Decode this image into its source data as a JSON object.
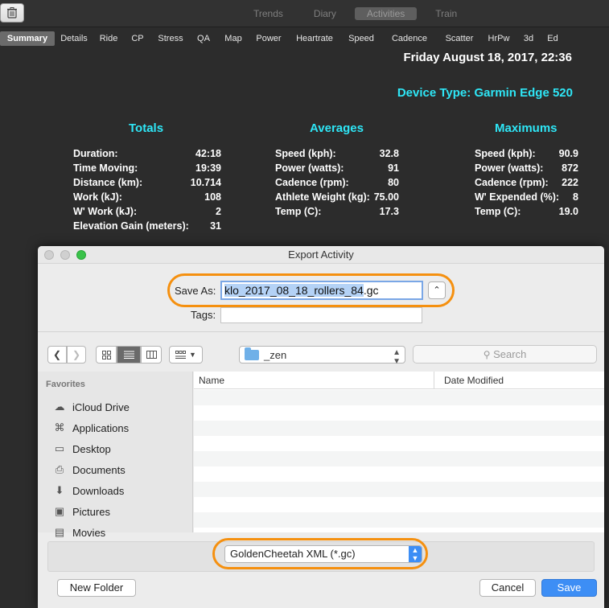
{
  "topbar": {
    "views": [
      "Trends",
      "Diary",
      "Activities",
      "Train"
    ],
    "active_view": 2
  },
  "tabs": {
    "items": [
      "Summary",
      "Details",
      "Ride",
      "CP",
      "Stress",
      "QA",
      "Map",
      "Power",
      "Heartrate",
      "Speed",
      "Cadence",
      "Scatter",
      "HrPw",
      "3d",
      "Ed"
    ],
    "active": 0
  },
  "summary": {
    "date": "Friday August 18, 2017, 22:36",
    "device": "Device Type: Garmin Edge 520",
    "totals": {
      "title": "Totals",
      "rows": [
        {
          "label": "Duration:",
          "value": "42:18"
        },
        {
          "label": "Time Moving:",
          "value": "19:39"
        },
        {
          "label": "Distance (km):",
          "value": "10.714"
        },
        {
          "label": "Work (kJ):",
          "value": "108"
        },
        {
          "label": "W' Work (kJ):",
          "value": "2"
        },
        {
          "label": "Elevation Gain (meters):",
          "value": "31"
        }
      ]
    },
    "averages": {
      "title": "Averages",
      "rows": [
        {
          "label": "Speed (kph):",
          "value": "32.8"
        },
        {
          "label": "Power (watts):",
          "value": "91"
        },
        {
          "label": "Cadence (rpm):",
          "value": "80"
        },
        {
          "label": "Athlete Weight (kg):",
          "value": "75.00"
        },
        {
          "label": "Temp (C):",
          "value": "17.3"
        }
      ]
    },
    "maximums": {
      "title": "Maximums",
      "rows": [
        {
          "label": "Speed (kph):",
          "value": "90.9"
        },
        {
          "label": "Power (watts):",
          "value": "872"
        },
        {
          "label": "Cadence (rpm):",
          "value": "222"
        },
        {
          "label": "W' Expended (%):",
          "value": "8"
        },
        {
          "label": "Temp (C):",
          "value": "19.0"
        }
      ]
    }
  },
  "dialog": {
    "title": "Export Activity",
    "save_as_label": "Save As:",
    "filename_selected": "klo_2017_08_18_rollers_84",
    "filename_ext": ".gc",
    "tags_label": "Tags:",
    "tags_value": "",
    "location": "_zen",
    "search_placeholder": "Search",
    "sidebar": {
      "heading": "Favorites",
      "items": [
        {
          "label": "iCloud Drive",
          "icon": "cloud-icon"
        },
        {
          "label": "Applications",
          "icon": "applications-icon"
        },
        {
          "label": "Desktop",
          "icon": "desktop-icon"
        },
        {
          "label": "Documents",
          "icon": "documents-icon"
        },
        {
          "label": "Downloads",
          "icon": "downloads-icon"
        },
        {
          "label": "Pictures",
          "icon": "camera-icon"
        },
        {
          "label": "Movies",
          "icon": "film-icon"
        }
      ]
    },
    "file_list": {
      "col_name": "Name",
      "col_date": "Date Modified"
    },
    "format": "GoldenCheetah XML (*.gc)",
    "new_folder_label": "New Folder",
    "cancel_label": "Cancel",
    "save_label": "Save"
  },
  "colors": {
    "accent_cyan": "#2ee6f6",
    "highlight_orange": "#f5900f",
    "macos_blue": "#3d8ef5"
  }
}
